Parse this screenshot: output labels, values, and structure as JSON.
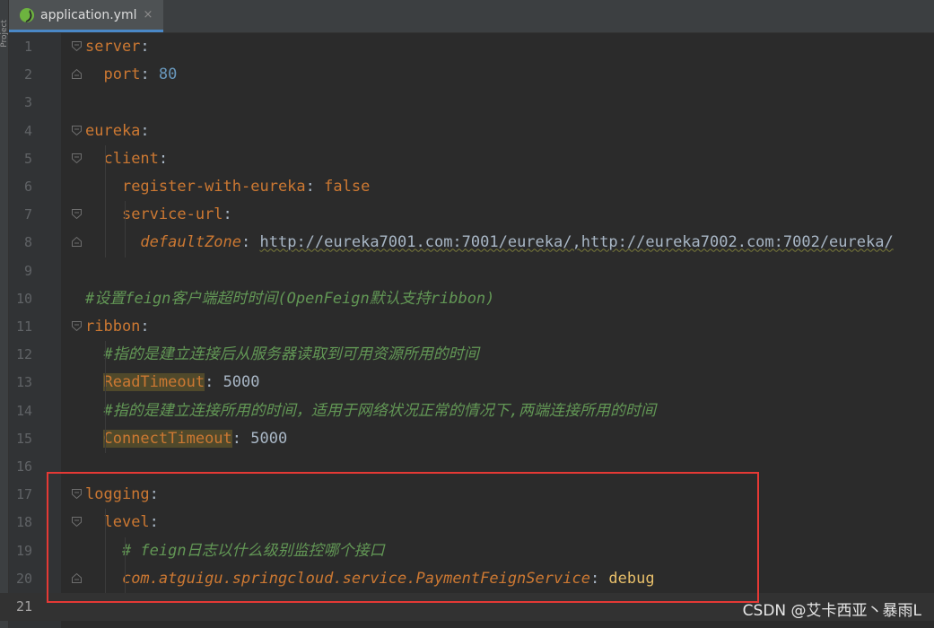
{
  "side_panel": {
    "label": "Project"
  },
  "tab": {
    "label": "application.yml",
    "close": "×",
    "icon": "spring-leaf-icon"
  },
  "lines": [
    {
      "n": "1",
      "segments": [
        {
          "t": "server",
          "c": "key"
        },
        {
          "t": ":",
          "c": "punc"
        }
      ]
    },
    {
      "n": "2",
      "segments": [
        {
          "t": "  ",
          "c": "punc"
        },
        {
          "t": "port",
          "c": "key"
        },
        {
          "t": ": ",
          "c": "punc"
        },
        {
          "t": "80",
          "c": "num"
        }
      ]
    },
    {
      "n": "3",
      "segments": []
    },
    {
      "n": "4",
      "segments": [
        {
          "t": "eureka",
          "c": "key"
        },
        {
          "t": ":",
          "c": "punc"
        }
      ]
    },
    {
      "n": "5",
      "segments": [
        {
          "t": "  ",
          "c": "punc"
        },
        {
          "t": "client",
          "c": "key"
        },
        {
          "t": ":",
          "c": "punc"
        }
      ]
    },
    {
      "n": "6",
      "segments": [
        {
          "t": "    ",
          "c": "punc"
        },
        {
          "t": "register-with-eureka",
          "c": "key"
        },
        {
          "t": ": ",
          "c": "punc"
        },
        {
          "t": "false",
          "c": "kw"
        }
      ]
    },
    {
      "n": "7",
      "segments": [
        {
          "t": "    ",
          "c": "punc"
        },
        {
          "t": "service-url",
          "c": "key"
        },
        {
          "t": ":",
          "c": "punc"
        }
      ]
    },
    {
      "n": "8",
      "segments": [
        {
          "t": "      ",
          "c": "punc"
        },
        {
          "t": "defaultZone",
          "c": "italic-key"
        },
        {
          "t": ": ",
          "c": "punc"
        },
        {
          "t": "http://eureka7001.com:7001/eureka/,http://eureka7002.com:7002/eureka/",
          "c": "url"
        }
      ]
    },
    {
      "n": "9",
      "segments": []
    },
    {
      "n": "10",
      "segments": [
        {
          "t": "#设置feign客户端超时时间(OpenFeign默认支持ribbon)",
          "c": "comment"
        }
      ]
    },
    {
      "n": "11",
      "segments": [
        {
          "t": "ribbon",
          "c": "key"
        },
        {
          "t": ":",
          "c": "punc"
        }
      ]
    },
    {
      "n": "12",
      "segments": [
        {
          "t": "  ",
          "c": "punc"
        },
        {
          "t": "#指的是建立连接后从服务器读取到可用资源所用的时间",
          "c": "comment"
        }
      ]
    },
    {
      "n": "13",
      "segments": [
        {
          "t": "  ",
          "c": "punc"
        },
        {
          "t": "ReadTimeout",
          "c": "key hl"
        },
        {
          "t": ": ",
          "c": "punc"
        },
        {
          "t": "5000",
          "c": "punc"
        }
      ]
    },
    {
      "n": "14",
      "segments": [
        {
          "t": "  ",
          "c": "punc"
        },
        {
          "t": "#指的是建立连接所用的时间，适用于网络状况正常的情况下,两端连接所用的时间",
          "c": "comment"
        }
      ]
    },
    {
      "n": "15",
      "segments": [
        {
          "t": "  ",
          "c": "punc"
        },
        {
          "t": "ConnectTimeout",
          "c": "key hl"
        },
        {
          "t": ": ",
          "c": "punc"
        },
        {
          "t": "5000",
          "c": "punc"
        }
      ]
    },
    {
      "n": "16",
      "segments": []
    },
    {
      "n": "17",
      "segments": [
        {
          "t": "logging",
          "c": "key"
        },
        {
          "t": ":",
          "c": "punc"
        }
      ]
    },
    {
      "n": "18",
      "segments": [
        {
          "t": "  ",
          "c": "punc"
        },
        {
          "t": "level",
          "c": "key"
        },
        {
          "t": ":",
          "c": "punc"
        }
      ]
    },
    {
      "n": "19",
      "segments": [
        {
          "t": "    ",
          "c": "punc"
        },
        {
          "t": "# feign日志以什么级别监控哪个接口",
          "c": "comment"
        }
      ]
    },
    {
      "n": "20",
      "segments": [
        {
          "t": "    ",
          "c": "punc"
        },
        {
          "t": "com.atguigu.springcloud.service.PaymentFeignService",
          "c": "italic-key"
        },
        {
          "t": ": ",
          "c": "punc"
        },
        {
          "t": "debug",
          "c": "debug"
        }
      ]
    },
    {
      "n": "21",
      "segments": []
    }
  ],
  "watermark": "CSDN @艾卡西亚丶暴雨L",
  "colors": {
    "key": "#cc7832",
    "number": "#6897bb",
    "comment": "#629755",
    "highlight": "#50492b",
    "annotation_box": "#e53935"
  }
}
